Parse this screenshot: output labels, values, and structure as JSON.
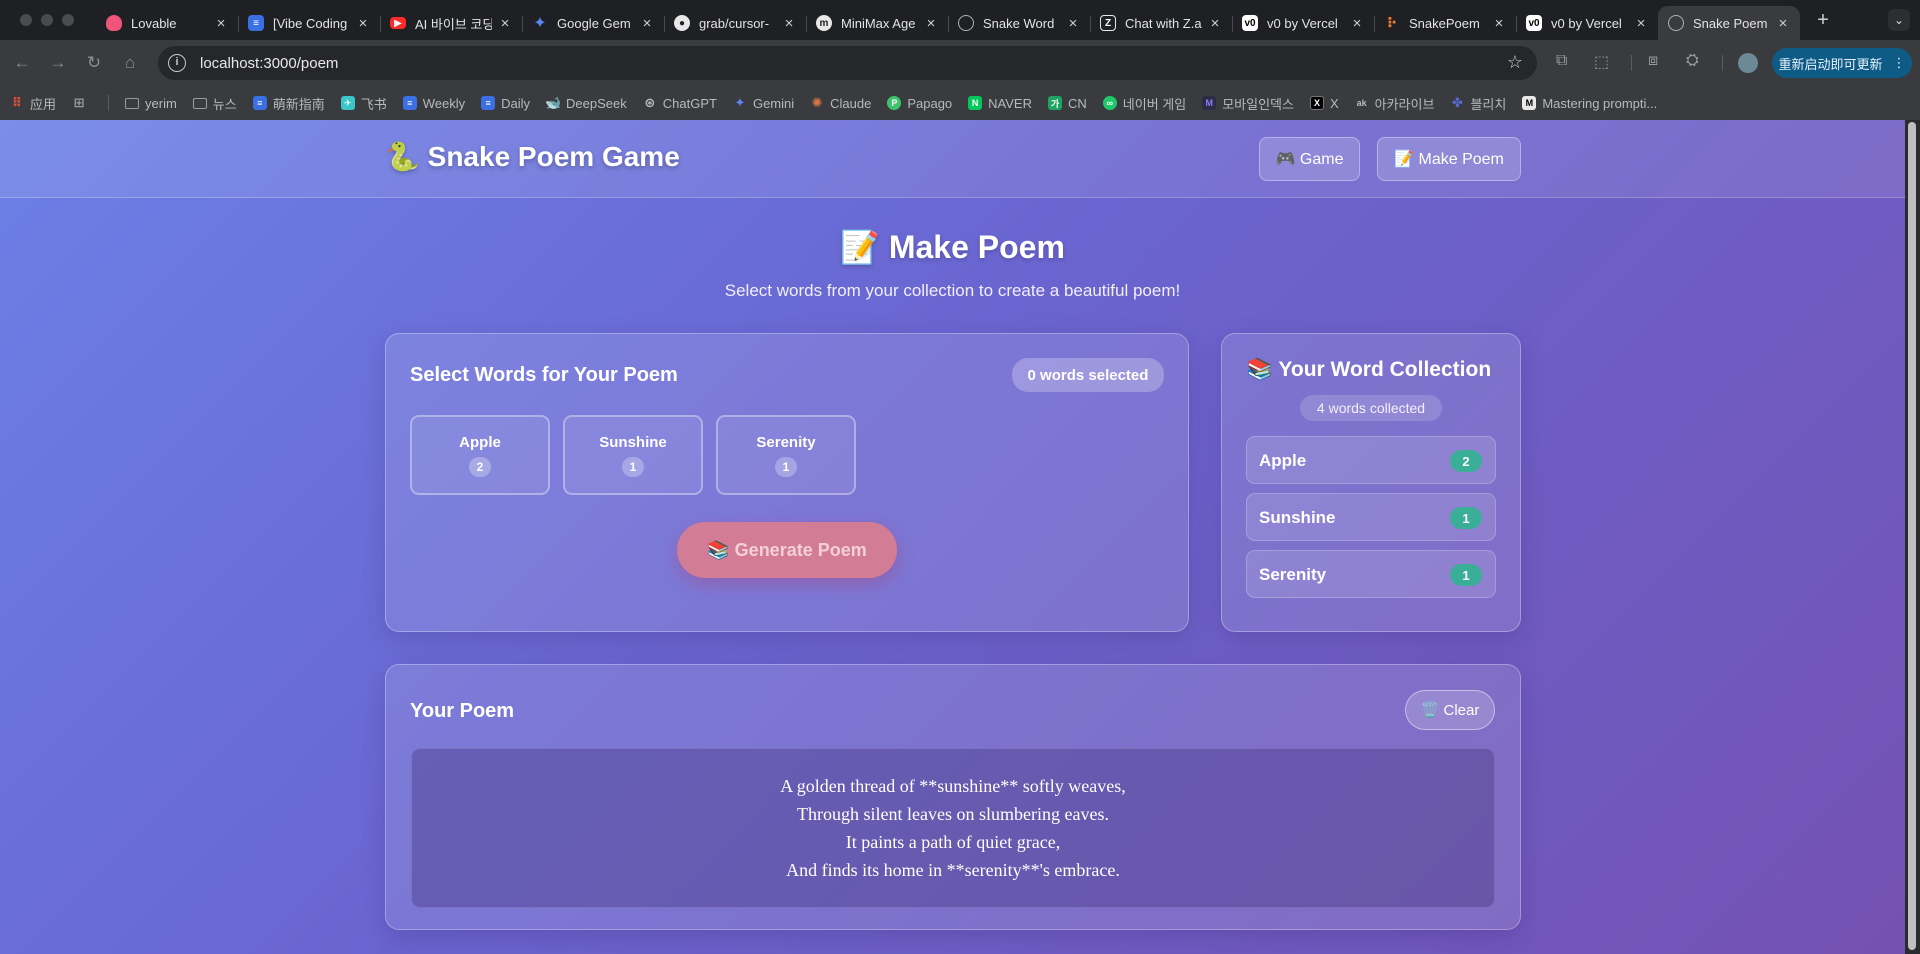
{
  "browser": {
    "tabs": [
      {
        "title": "Lovable",
        "favicon": "lovable-heart-icon",
        "color": "#f0547b"
      },
      {
        "title": "[Vibe Coding",
        "favicon": "docs-icon",
        "color": "#3b6fe4"
      },
      {
        "title": "AI 바이브 코딩",
        "favicon": "youtube-icon",
        "color": "#ff2a2a"
      },
      {
        "title": "Google Gem",
        "favicon": "gemini-icon",
        "color": "#5a86f2"
      },
      {
        "title": "grab/cursor-",
        "favicon": "github-icon",
        "color": "#e8e8e8"
      },
      {
        "title": "MiniMax Age",
        "favicon": "minimax-icon",
        "color": "#e8e8e8"
      },
      {
        "title": "Snake Word",
        "favicon": "globe-icon",
        "color": "#b0b0b0"
      },
      {
        "title": "Chat with Z.a",
        "favicon": "z-icon",
        "color": "#e8e8e8"
      },
      {
        "title": "v0 by Vercel",
        "favicon": "v0-icon",
        "color": "#ffffff"
      },
      {
        "title": "SnakePoem",
        "favicon": "snakepoem-icon",
        "color": "#f07a2c"
      },
      {
        "title": "v0 by Vercel",
        "favicon": "v0-icon",
        "color": "#ffffff"
      },
      {
        "title": "Snake Poem",
        "favicon": "globe-icon",
        "color": "#b0b0b0",
        "active": true
      }
    ],
    "new_tab": "+",
    "tab_menu": "⌄",
    "url": "localhost:3000/poem",
    "update_button": "重新启动即可更新",
    "bookmarks": [
      {
        "label": "应用",
        "icon": "apps-grid-icon",
        "color": "#e04b3a"
      },
      {
        "label": "",
        "icon": "tab-groups-icon",
        "color": "#9a9ba0"
      },
      {
        "label": "yerim",
        "icon": "folder-icon",
        "color": "#9a9ba0"
      },
      {
        "label": "뉴스",
        "icon": "folder-icon",
        "color": "#9a9ba0"
      },
      {
        "label": "萌新指南",
        "icon": "docs-icon",
        "color": "#3b6fe4"
      },
      {
        "label": "飞书",
        "icon": "feishu-icon",
        "color": "#3ac6c6"
      },
      {
        "label": "Weekly",
        "icon": "docs-icon",
        "color": "#3b6fe4"
      },
      {
        "label": "Daily",
        "icon": "docs-icon",
        "color": "#3b6fe4"
      },
      {
        "label": "DeepSeek",
        "icon": "deepseek-icon",
        "color": "#4d6bfe"
      },
      {
        "label": "ChatGPT",
        "icon": "chatgpt-icon",
        "color": "#9a9ba0"
      },
      {
        "label": "Gemini",
        "icon": "gemini-icon",
        "color": "#5a86f2"
      },
      {
        "label": "Claude",
        "icon": "claude-icon",
        "color": "#d9774b"
      },
      {
        "label": "Papago",
        "icon": "papago-icon",
        "color": "#3cc36c"
      },
      {
        "label": "NAVER",
        "icon": "naver-icon",
        "color": "#03c75a"
      },
      {
        "label": "CN",
        "icon": "ka-icon",
        "color": "#1ea362"
      },
      {
        "label": "네이버 게임",
        "icon": "naver-game-icon",
        "color": "#1fc96b"
      },
      {
        "label": "모바일인덱스",
        "icon": "mobileindex-icon",
        "color": "#5a3fd6"
      },
      {
        "label": "X",
        "icon": "x-icon",
        "color": "#e8e8e8"
      },
      {
        "label": "아카라이브",
        "icon": "arca-icon",
        "color": "#9a9ba0"
      },
      {
        "label": "블리치",
        "icon": "bleach-icon",
        "color": "#5a6bd6"
      },
      {
        "label": "Mastering prompti...",
        "icon": "medium-icon",
        "color": "#e8e8e8"
      }
    ]
  },
  "app": {
    "brand": "🐍 Snake Poem Game",
    "nav": {
      "game": "🎮 Game",
      "make_poem": "📝 Make Poem"
    },
    "title": "📝 Make Poem",
    "subtitle": "Select words from your collection to create a beautiful poem!",
    "select_panel": {
      "title": "Select Words for Your Poem",
      "selected_count": "0 words selected",
      "words": [
        {
          "word": "Apple",
          "count": "2"
        },
        {
          "word": "Sunshine",
          "count": "1"
        },
        {
          "word": "Serenity",
          "count": "1"
        }
      ],
      "generate_button": "📚 Generate Poem"
    },
    "collection": {
      "title": "📚 Your Word Collection",
      "count": "4 words collected",
      "items": [
        {
          "word": "Apple",
          "count": "2"
        },
        {
          "word": "Sunshine",
          "count": "1"
        },
        {
          "word": "Serenity",
          "count": "1"
        }
      ]
    },
    "poem": {
      "title": "Your Poem",
      "clear_button": "🗑️ Clear",
      "lines": [
        "A golden thread of **sunshine** softly weaves,",
        "Through silent leaves on slumbering eaves.",
        "It paints a path of quiet grace,",
        "And finds its home in **serenity**'s embrace."
      ]
    }
  },
  "colors": {
    "gradient_start": "#6b80e6",
    "gradient_end": "#7452b3",
    "badge_green": "#3aae97",
    "generate_button": "#d27c96"
  }
}
